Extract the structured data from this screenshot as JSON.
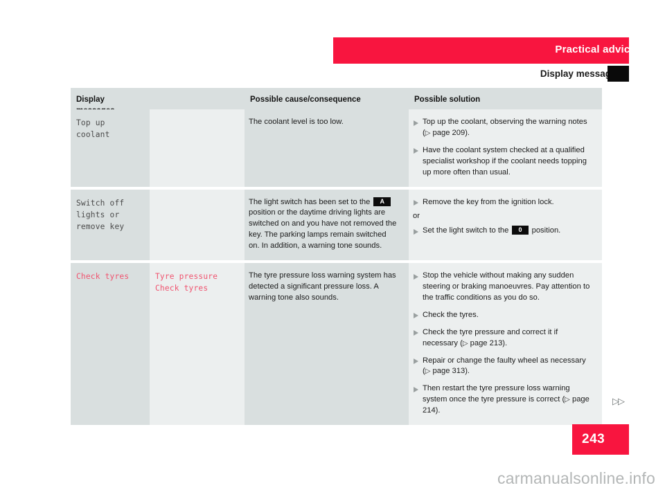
{
  "header": {
    "chapter": "Practical advice",
    "section": "Display messages"
  },
  "table": {
    "columns": [
      "Display messages",
      "",
      "Possible cause/consequence",
      "Possible solution"
    ],
    "rows": [
      {
        "message": "Top up coolant",
        "message_alt": "",
        "cause": "The coolant level is too low.",
        "solutions": [
          {
            "type": "bullet",
            "parts": [
              {
                "t": "text",
                "v": "Top up the coolant, observing the warning notes ("
              },
              {
                "t": "arrow",
                "v": "▷"
              },
              {
                "t": "text",
                "v": " page 209)."
              }
            ]
          },
          {
            "type": "bullet",
            "parts": [
              {
                "t": "text",
                "v": "Have the coolant system checked at a qualified specialist workshop if the coolant needs topping up more often than usual."
              }
            ]
          }
        ]
      },
      {
        "message": "Switch off\nlights or\nremove key",
        "message_alt": "",
        "cause_parts": [
          {
            "t": "text",
            "v": "The light switch has been set to the "
          },
          {
            "t": "badge",
            "v": "A"
          },
          {
            "t": "text",
            "v": " position or the daytime driving lights are switched on and you have not removed the key. The parking lamps remain switched on. In addition, a warning tone sounds."
          }
        ],
        "solutions": [
          {
            "type": "bullet",
            "parts": [
              {
                "t": "text",
                "v": "Remove the key from the ignition lock."
              }
            ]
          },
          {
            "type": "plain",
            "parts": [
              {
                "t": "text",
                "v": "or"
              }
            ]
          },
          {
            "type": "bullet",
            "parts": [
              {
                "t": "text",
                "v": "Set the light switch to the "
              },
              {
                "t": "badge",
                "v": "0"
              },
              {
                "t": "text",
                "v": " position."
              }
            ]
          }
        ]
      },
      {
        "message": "Check tyres",
        "message_alt": "Tyre pressure\nCheck tyres",
        "cause": "The tyre pressure loss warning system has detected a significant pressure loss. A warning tone also sounds.",
        "solutions": [
          {
            "type": "bullet",
            "parts": [
              {
                "t": "text",
                "v": "Stop the vehicle without making any sudden steering or braking manoeuvres. Pay attention to the traffic conditions as you do so."
              }
            ]
          },
          {
            "type": "bullet",
            "parts": [
              {
                "t": "text",
                "v": "Check the tyres."
              }
            ]
          },
          {
            "type": "bullet",
            "parts": [
              {
                "t": "text",
                "v": "Check the tyre pressure and correct it if necessary ("
              },
              {
                "t": "arrow",
                "v": "▷"
              },
              {
                "t": "text",
                "v": " page 213)."
              }
            ]
          },
          {
            "type": "bullet",
            "parts": [
              {
                "t": "text",
                "v": "Repair or change the faulty wheel as necessary ("
              },
              {
                "t": "arrow",
                "v": "▷"
              },
              {
                "t": "text",
                "v": " page 313)."
              }
            ]
          },
          {
            "type": "bullet",
            "parts": [
              {
                "t": "text",
                "v": "Then restart the tyre pressure loss warning system once the tyre pressure is correct ("
              },
              {
                "t": "arrow",
                "v": "▷"
              },
              {
                "t": "text",
                "v": " page 214)."
              }
            ]
          }
        ]
      }
    ]
  },
  "footer": {
    "next_marker": "▷▷",
    "page_number": "243",
    "watermark": "carmanualsonline.info"
  },
  "colors": {
    "brand_red": "#f8153f",
    "col_dark": "#d9dfdf",
    "col_light": "#ecefef",
    "mono_grey": "#4a4a4a",
    "mono_red": "#f0536f",
    "badge_black": "#0c0c0c"
  }
}
